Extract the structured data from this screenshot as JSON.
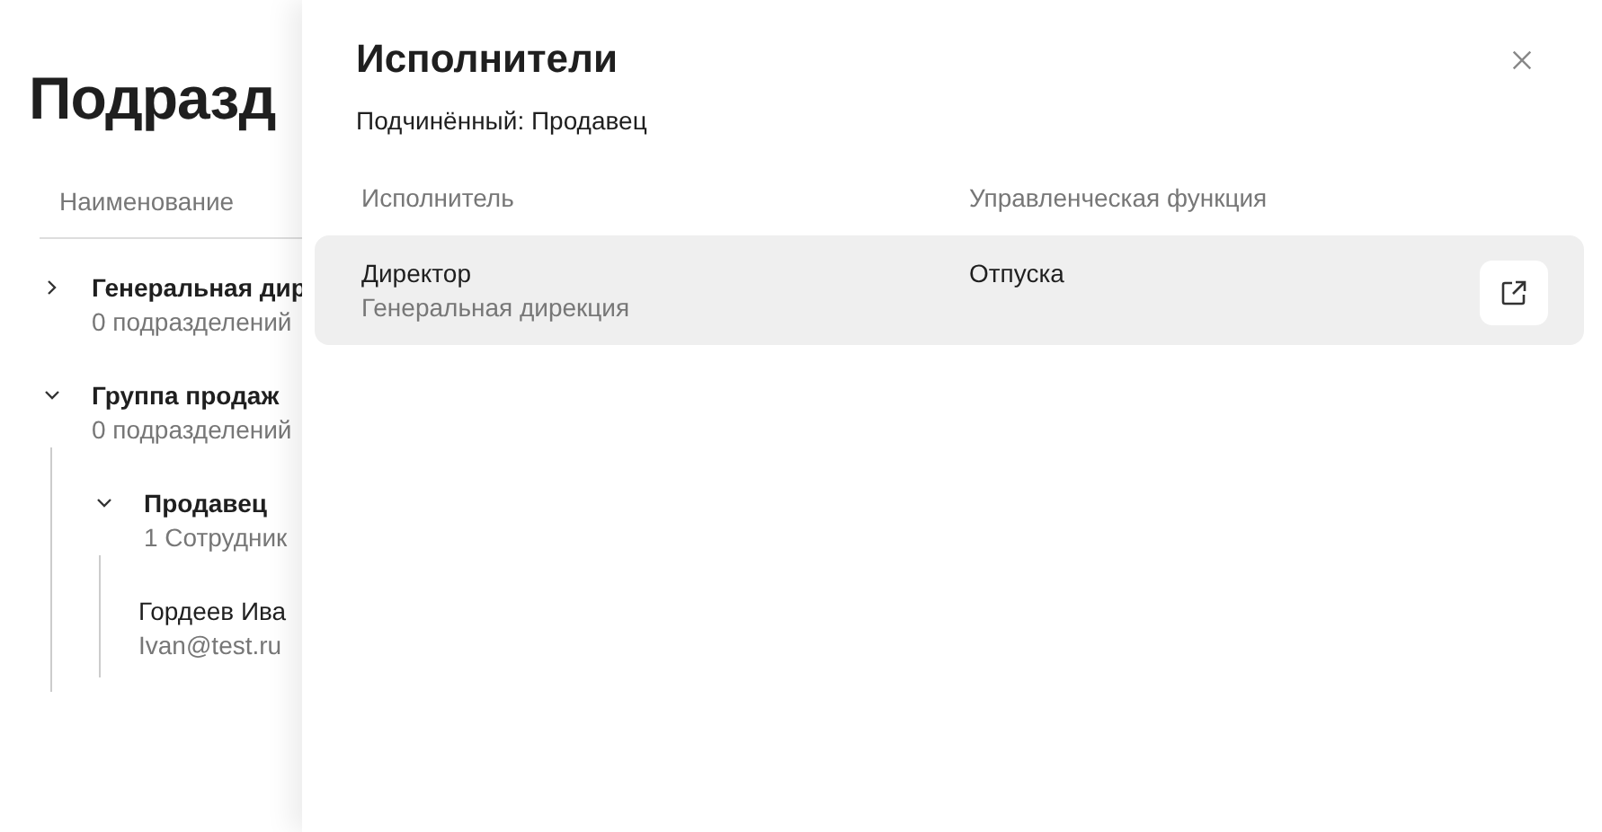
{
  "page": {
    "title": "Подразд",
    "column": "Наименование",
    "tree": [
      {
        "kind": "unit",
        "name": "Генеральная дир",
        "meta": "0 подразделений",
        "expanded": false
      },
      {
        "kind": "unit",
        "name": "Группа продаж",
        "meta": "0 подразделений",
        "expanded": true,
        "children": [
          {
            "kind": "unit",
            "name": "Продавец",
            "meta": "1 Сотрудник",
            "expanded": true,
            "children": [
              {
                "kind": "employee",
                "name": "Гордеев Ива",
                "meta": "Ivan@test.ru"
              }
            ]
          }
        ]
      }
    ]
  },
  "drawer": {
    "title": "Исполнители",
    "subtitle": "Подчинённый: Продавец",
    "columns": [
      "Исполнитель",
      "Управленческая функция"
    ],
    "rows": [
      {
        "name": "Директор",
        "department": "Генеральная дирекция",
        "function": "Отпуска"
      }
    ]
  }
}
